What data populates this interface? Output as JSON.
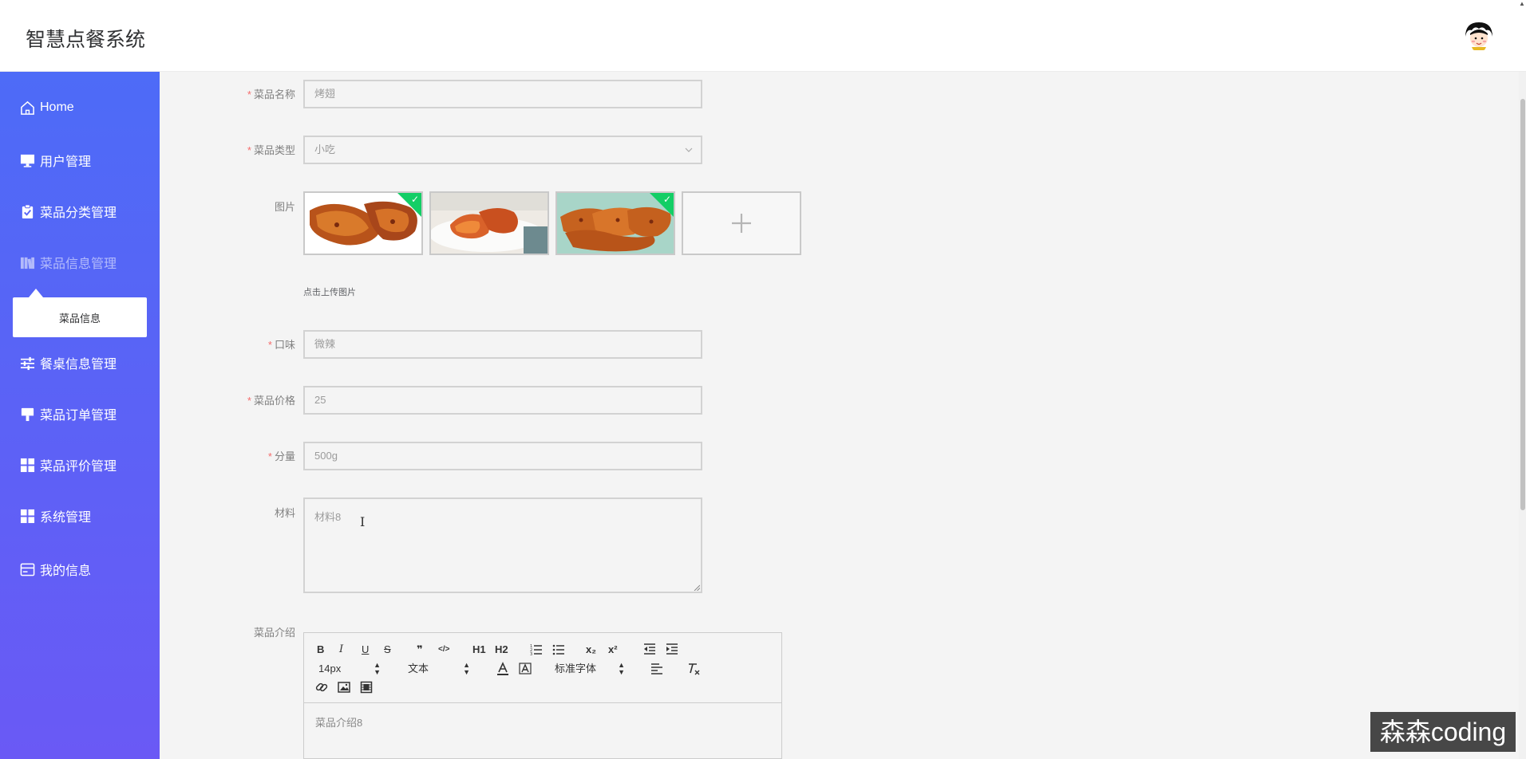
{
  "header": {
    "app_title": "智慧点餐系统"
  },
  "sidebar": {
    "items": [
      {
        "label": "Home",
        "icon": "home-icon"
      },
      {
        "label": "用户管理",
        "icon": "monitor-icon"
      },
      {
        "label": "菜品分类管理",
        "icon": "clipboard-check-icon"
      },
      {
        "label": "菜品信息管理",
        "icon": "books-icon"
      },
      {
        "label": "餐桌信息管理",
        "icon": "sliders-icon"
      },
      {
        "label": "菜品订单管理",
        "icon": "brush-icon"
      },
      {
        "label": "菜品评价管理",
        "icon": "grid-icon"
      },
      {
        "label": "系统管理",
        "icon": "grid-icon"
      },
      {
        "label": "我的信息",
        "icon": "card-icon"
      }
    ],
    "active_item": "菜品信息管理",
    "sub_item": "菜品信息"
  },
  "form": {
    "name": {
      "label": "菜品名称",
      "value": "烤翅"
    },
    "type": {
      "label": "菜品类型",
      "value": "小吃"
    },
    "images": {
      "label": "图片",
      "hint": "点击上传图片",
      "count": 3
    },
    "taste": {
      "label": "口味",
      "value": "微辣"
    },
    "price": {
      "label": "菜品价格",
      "value": "25"
    },
    "portion": {
      "label": "分量",
      "value": "500g"
    },
    "material": {
      "label": "材料",
      "value": "材料8"
    },
    "intro": {
      "label": "菜品介绍",
      "value": "菜品介绍8"
    },
    "required_mark": "*"
  },
  "editor": {
    "buttons_row1": [
      "B",
      "I",
      "U",
      "S",
      "❞",
      "</>",
      "H1",
      "H2",
      "ol",
      "ul",
      "x₂",
      "x²",
      "outdent",
      "indent"
    ],
    "size": "14px",
    "header": "文本",
    "font": "标准字体"
  },
  "watermark": "森森coding",
  "colors": {
    "sidebar_top": "#4d6bf7",
    "sidebar_bottom": "#6a59f5",
    "required": "#f56c6c",
    "upload_check": "#13ce66"
  }
}
